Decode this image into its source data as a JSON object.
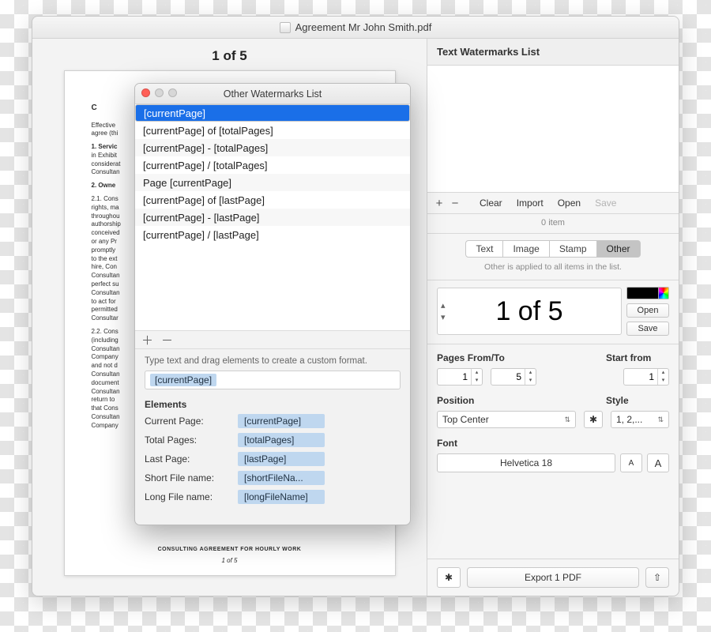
{
  "window": {
    "title": "Agreement Mr John Smith.pdf"
  },
  "doc": {
    "indicator": "1 of 5",
    "footer": "CONSULTING AGREEMENT FOR HOURLY WORK",
    "pagenum": "1 of 5"
  },
  "sidebar": {
    "header": "Text Watermarks List",
    "toolbar": {
      "plus": "+",
      "minus": "−",
      "clear": "Clear",
      "import": "Import",
      "open": "Open",
      "save": "Save"
    },
    "count": "0 item",
    "tabs": {
      "text": "Text",
      "image": "Image",
      "stamp": "Stamp",
      "other": "Other"
    },
    "applied": "Other is applied to all items in the list.",
    "preview": "1 of 5",
    "openBtn": "Open",
    "saveBtn": "Save",
    "pagesLabel": "Pages From/To",
    "startLabel": "Start from",
    "pagesFrom": "1",
    "pagesTo": "5",
    "startFrom": "1",
    "positionLabel": "Position",
    "styleLabel": "Style",
    "positionVal": "Top Center",
    "styleVal": "1, 2,...",
    "fontLabel": "Font",
    "fontVal": "Helvetica 18",
    "export": "Export 1 PDF"
  },
  "popup": {
    "title": "Other Watermarks List",
    "items": [
      "[currentPage]",
      "[currentPage] of [totalPages]",
      "[currentPage] - [totalPages]",
      "[currentPage] / [totalPages]",
      "Page [currentPage]",
      "[currentPage] of [lastPage]",
      "[currentPage] - [lastPage]",
      "[currentPage] / [lastPage]"
    ],
    "selectedIndex": 0,
    "hint": "Type text and drag elements to create a custom format.",
    "inputToken": "[currentPage]",
    "elementsHeader": "Elements",
    "elements": [
      {
        "k": "Current Page:",
        "v": "[currentPage]"
      },
      {
        "k": "Total Pages:",
        "v": "[totalPages]"
      },
      {
        "k": "Last Page:",
        "v": "[lastPage]"
      },
      {
        "k": "Short File name:",
        "v": "[shortFileNa..."
      },
      {
        "k": "Long File name:",
        "v": "[longFileName]"
      }
    ]
  }
}
